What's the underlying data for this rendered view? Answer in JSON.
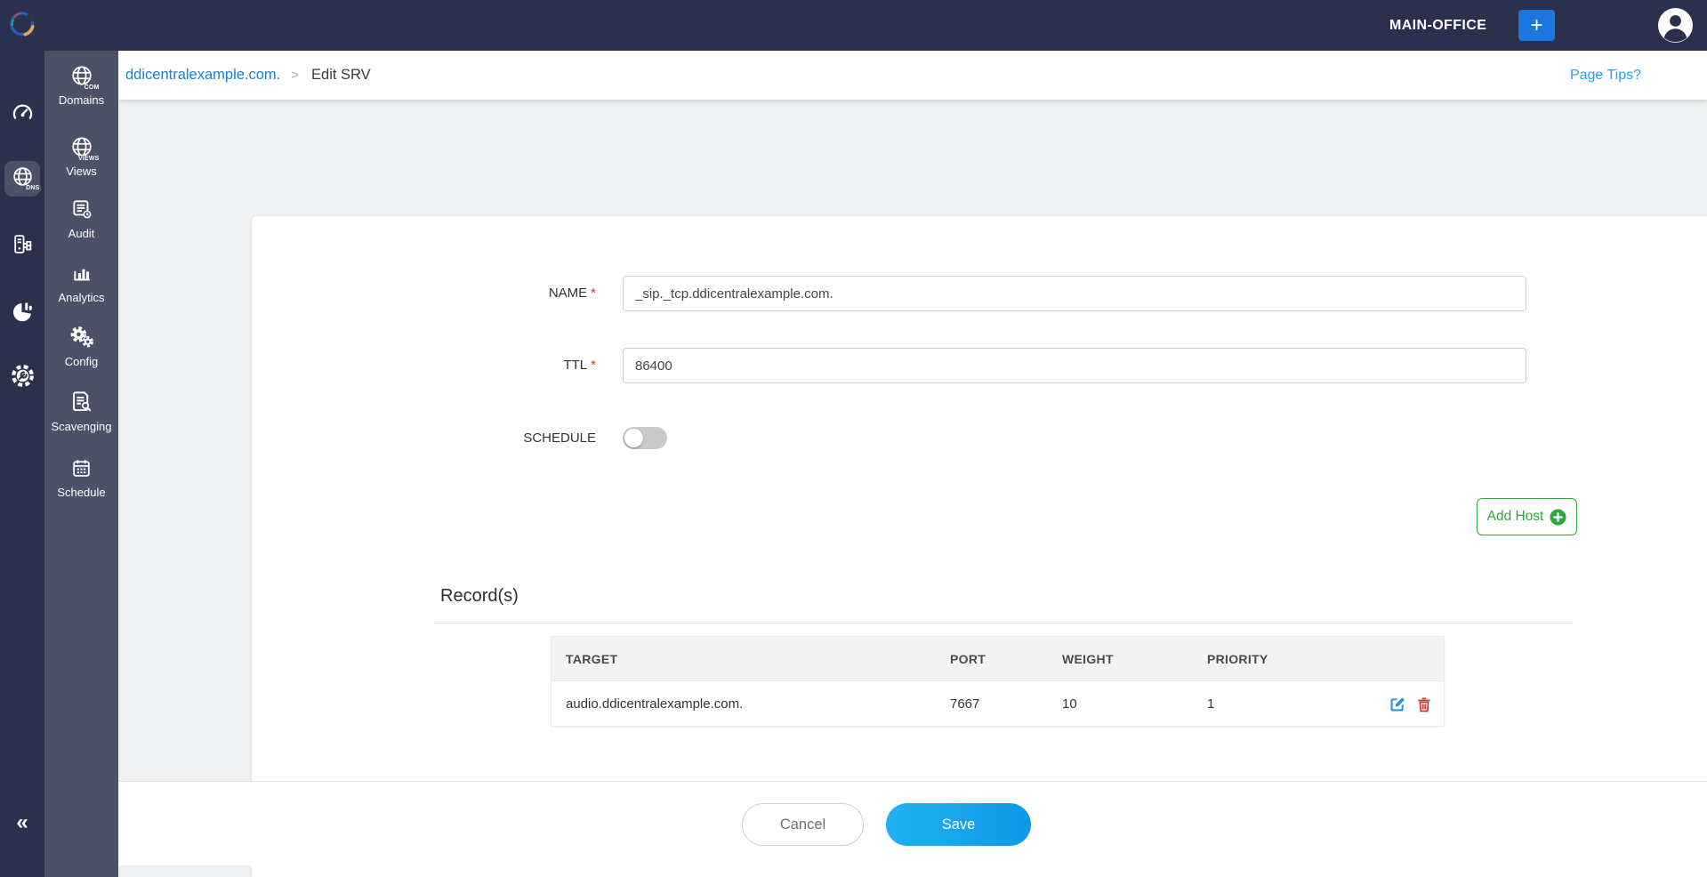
{
  "topbar": {
    "site_label": "MAIN-OFFICE",
    "add_button": "+"
  },
  "rail": {
    "dns_tag": "DNS",
    "collapse_glyph": "«"
  },
  "sidebar": {
    "items": [
      {
        "label": "Domains",
        "tag": "COM"
      },
      {
        "label": "Views",
        "tag": "VIEWS"
      },
      {
        "label": "Audit"
      },
      {
        "label": "Analytics"
      },
      {
        "label": "Config"
      },
      {
        "label": "Scavenging"
      },
      {
        "label": "Schedule"
      }
    ]
  },
  "breadcrumb": {
    "domain": "ddicentralexample.com.",
    "separator": ">",
    "current": "Edit SRV"
  },
  "page_tips": "Page Tips?",
  "form": {
    "name_label": "NAME",
    "ttl_label": "TTL",
    "schedule_label": "SCHEDULE",
    "required_marker": "*",
    "name_value": "_sip._tcp.ddicentralexample.com.",
    "ttl_value": "86400",
    "schedule_state": "off"
  },
  "add_host_label": "Add Host",
  "records": {
    "heading": "Record(s)",
    "columns": [
      "TARGET",
      "PORT",
      "WEIGHT",
      "PRIORITY"
    ],
    "rows": [
      {
        "target": "audio.ddicentralexample.com.",
        "port": "7667",
        "weight": "10",
        "priority": "1"
      }
    ]
  },
  "footer": {
    "cancel_label": "Cancel",
    "save_label": "Save"
  },
  "colors": {
    "topbar": "#2b314c",
    "sidebar": "#4b5268",
    "breadcrumb_link": "#1b7fd2",
    "page_tips": "#22a2f2",
    "save_button": "#17a3eb",
    "add_host_green": "#2ea73e",
    "edit_icon": "#1b97e3",
    "delete_icon": "#d92f2f"
  }
}
